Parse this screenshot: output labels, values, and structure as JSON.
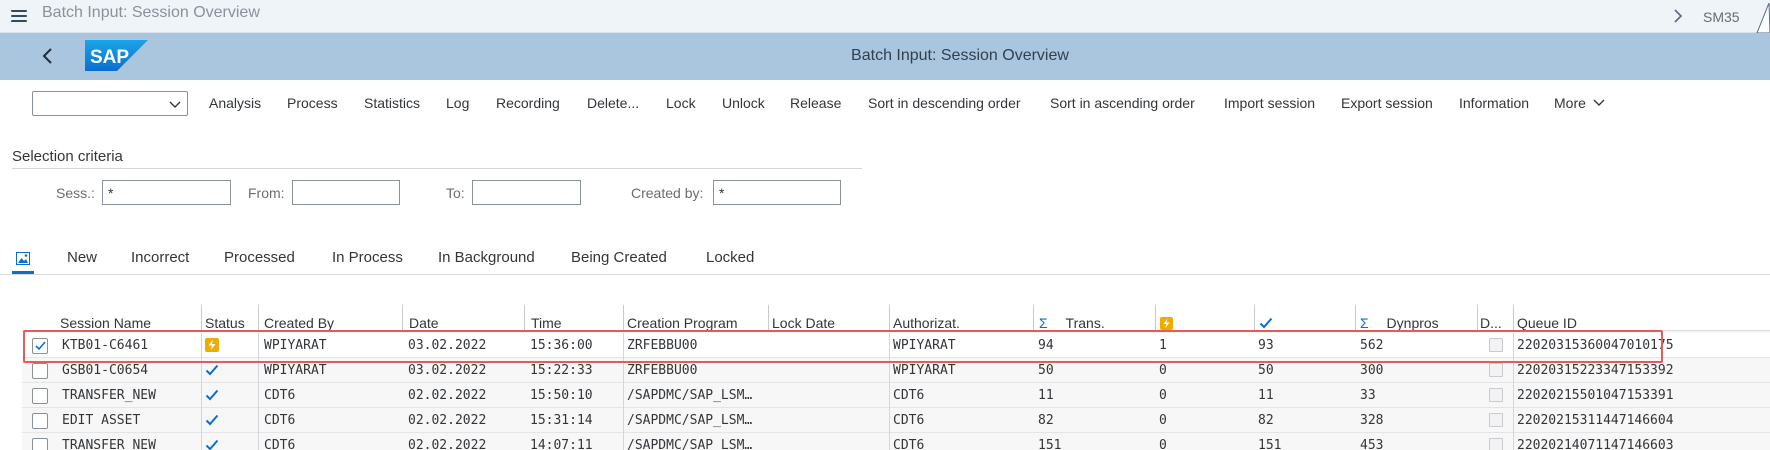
{
  "titlebar": {
    "title": "Batch Input: Session Overview",
    "tcode": "SM35"
  },
  "shellbar": {
    "title": "Batch Input: Session Overview",
    "logo_text": "SAP",
    "brand_color": "#0a6ed1"
  },
  "toolbar": {
    "select_value": "",
    "buttons": [
      "Analysis",
      "Process",
      "Statistics",
      "Log",
      "Recording",
      "Delete...",
      "Lock",
      "Unlock",
      "Release",
      "Sort in descending order",
      "Sort in ascending order",
      "Import session",
      "Export session",
      "Information",
      "More"
    ]
  },
  "selection": {
    "title": "Selection criteria",
    "sess_label": "Sess.:",
    "sess_value": "*",
    "from_label": "From:",
    "from_value": "",
    "to_label": "To:",
    "to_value": "",
    "created_by_label": "Created by:",
    "created_by_value": "*"
  },
  "tabs": [
    "New",
    "Incorrect",
    "Processed",
    "In Process",
    "In Background",
    "Being Created",
    "Locked"
  ],
  "grid": {
    "headers": {
      "session_name": "Session Name",
      "status": "Status",
      "created_by": "Created By",
      "date": "Date",
      "time": "Time",
      "creation_program": "Creation Program",
      "lock_date": "Lock Date",
      "authorizat": "Authorizat.",
      "trans": "Trans.",
      "dynpros": "Dynpros",
      "d": "D...",
      "queue_id": "Queue ID"
    },
    "rows": [
      {
        "selected": true,
        "session": "KTB01-C6461",
        "status": "error",
        "created_by": "WPIYARAT",
        "date": "03.02.2022",
        "time": "15:36:00",
        "program": "ZRFEBBU00",
        "lock_date": "",
        "auth": "WPIYARAT",
        "trans": "94",
        "errors": "1",
        "processed": "93",
        "dynpros": "562",
        "queue_id": "22020315360047010175"
      },
      {
        "selected": false,
        "session": "GSB01-C0654",
        "status": "ok",
        "created_by": "WPIYARAT",
        "date": "03.02.2022",
        "time": "15:22:33",
        "program": "ZRFEBBU00",
        "lock_date": "",
        "auth": "WPIYARAT",
        "trans": "50",
        "errors": "0",
        "processed": "50",
        "dynpros": "300",
        "queue_id": "22020315223347153392"
      },
      {
        "selected": false,
        "session": "TRANSFER_NEW",
        "status": "ok",
        "created_by": "CDT6",
        "date": "02.02.2022",
        "time": "15:50:10",
        "program": "/SAPDMC/SAP_LSM…",
        "lock_date": "",
        "auth": "CDT6",
        "trans": "11",
        "errors": "0",
        "processed": "11",
        "dynpros": "33",
        "queue_id": "22020215501047153391"
      },
      {
        "selected": false,
        "session": "EDIT ASSET",
        "status": "ok",
        "created_by": "CDT6",
        "date": "02.02.2022",
        "time": "15:31:14",
        "program": "/SAPDMC/SAP_LSM…",
        "lock_date": "",
        "auth": "CDT6",
        "trans": "82",
        "errors": "0",
        "processed": "82",
        "dynpros": "328",
        "queue_id": "22020215311447146604"
      },
      {
        "selected": false,
        "session": "TRANSFER_NEW",
        "status": "ok",
        "created_by": "CDT6",
        "date": "02.02.2022",
        "time": "14:07:11",
        "program": "/SAPDMC/SAP_LSM…",
        "lock_date": "",
        "auth": "CDT6",
        "trans": "151",
        "errors": "0",
        "processed": "151",
        "dynpros": "453",
        "queue_id": "22020214071147146603"
      }
    ]
  }
}
